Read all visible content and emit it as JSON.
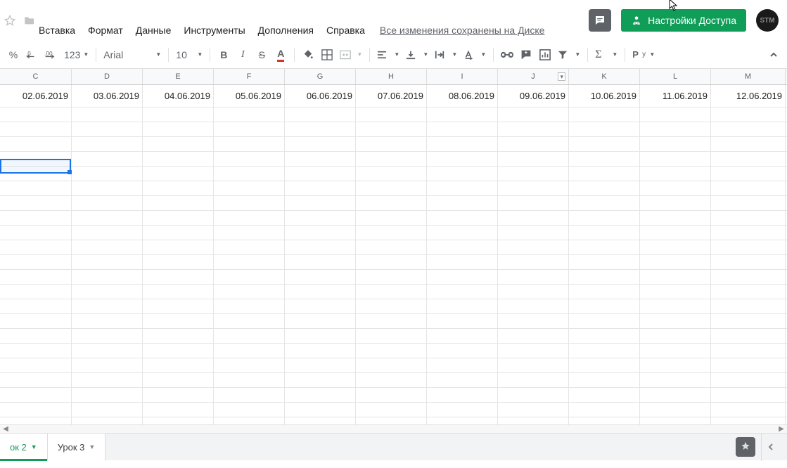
{
  "menu": {
    "insert": "Вставка",
    "format": "Формат",
    "data": "Данные",
    "tools": "Инструменты",
    "addons": "Дополнения",
    "help": "Справка"
  },
  "save_status": "Все изменения сохранены на Диске",
  "share_label": "Настройки Доступа",
  "avatar_text": "STM",
  "toolbar": {
    "percent": "%",
    "dec_dec": ".0",
    "inc_dec": ".00",
    "more_formats": "123",
    "font": "Arial",
    "size": "10",
    "bold": "B",
    "italic": "I",
    "strike": "S",
    "textcolor": "A"
  },
  "columns": [
    "C",
    "D",
    "E",
    "F",
    "G",
    "H",
    "I",
    "J",
    "K",
    "L",
    "M"
  ],
  "filter_col_index": 7,
  "row1": [
    "02.06.2019",
    "03.06.2019",
    "04.06.2019",
    "05.06.2019",
    "06.06.2019",
    "07.06.2019",
    "08.06.2019",
    "09.06.2019",
    "10.06.2019",
    "11.06.2019",
    "12.06.2019"
  ],
  "tabs": {
    "active": "ок 2",
    "other": "Урок 3"
  }
}
